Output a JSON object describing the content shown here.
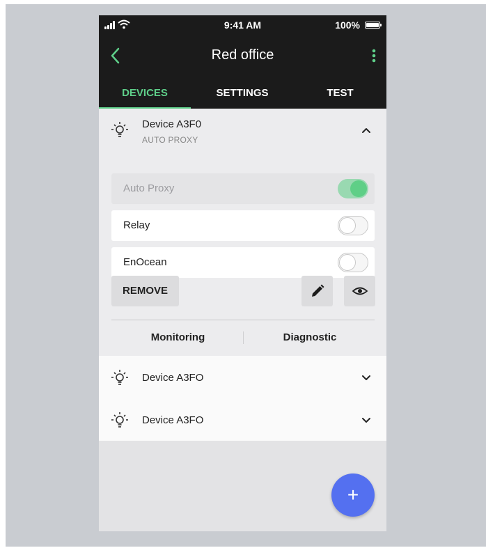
{
  "status_bar": {
    "time": "9:41 AM",
    "battery": "100%"
  },
  "nav": {
    "title": "Red office"
  },
  "tabs": [
    {
      "label": "DEVICES",
      "active": true
    },
    {
      "label": "SETTINGS",
      "active": false
    },
    {
      "label": "TEST",
      "active": false
    }
  ],
  "expanded_device": {
    "name": "Device  A3F0",
    "subtitle": "AUTO PROXY",
    "options": [
      {
        "label": "Auto Proxy",
        "enabled": true,
        "disabled": true
      },
      {
        "label": "Relay",
        "enabled": false,
        "disabled": false
      },
      {
        "label": "EnOcean",
        "enabled": false,
        "disabled": false
      }
    ],
    "remove_label": "REMOVE",
    "links": {
      "monitoring": "Monitoring",
      "diagnostic": "Diagnostic"
    }
  },
  "devices": [
    {
      "name": "Device A3FO"
    },
    {
      "name": "Device A3FO"
    }
  ],
  "fab": {
    "symbol": "+"
  },
  "colors": {
    "accent": "#5fd08a",
    "fab": "#5470f0",
    "header": "#1b1b1b"
  },
  "icons": {
    "back": "chevron-left-icon",
    "more": "kebab-menu-icon",
    "device": "lightbulb-icon",
    "expand": "chevron-up-icon",
    "collapse": "chevron-down-icon",
    "edit": "pencil-icon",
    "view": "eye-icon"
  }
}
